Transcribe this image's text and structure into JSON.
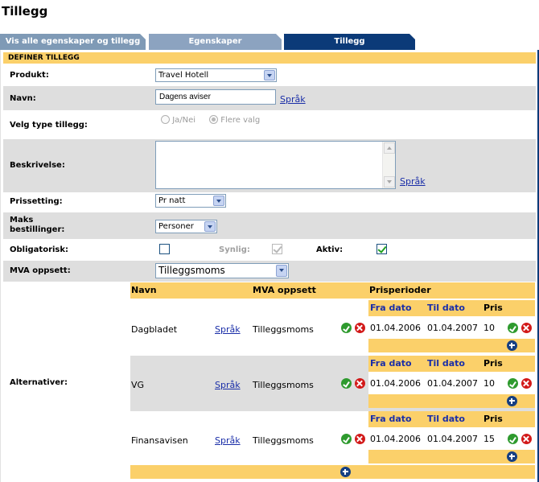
{
  "page": {
    "title": "Tillegg"
  },
  "tabs": [
    {
      "label": "Vis alle egenskaper og tillegg"
    },
    {
      "label": "Egenskaper"
    },
    {
      "label": "Tillegg"
    }
  ],
  "section": {
    "title": "DEFINER TILLEGG"
  },
  "form": {
    "produkt": {
      "label": "Produkt:",
      "value": "Travel Hotell"
    },
    "navn": {
      "label": "Navn:",
      "value": "Dagens aviser",
      "lang_link": "Språk"
    },
    "type": {
      "label": "Velg type tillegg:",
      "option_a": "Ja/Nei",
      "option_b": "Flere valg",
      "selected": "Flere valg"
    },
    "beskrivelse": {
      "label": "Beskrivelse:",
      "value": "",
      "lang_link": "Språk"
    },
    "prissetting": {
      "label": "Prissetting:",
      "value": "Pr natt"
    },
    "maks": {
      "label_line1": "Maks",
      "label_line2": "bestillinger:",
      "value": "Personer"
    },
    "obligatorisk": {
      "label": "Obligatorisk:",
      "checked": false
    },
    "synlig": {
      "label": "Synlig:",
      "checked": true
    },
    "aktiv": {
      "label": "Aktiv:",
      "checked": true
    },
    "mva": {
      "label": "MVA oppsett:",
      "value": "Tilleggsmoms"
    },
    "alternativer_label": "Alternativer:"
  },
  "alternatives": {
    "headers": {
      "navn": "Navn",
      "mva": "MVA oppsett",
      "prisperioder": "Prisperioder"
    },
    "period_headers": {
      "fra": "Fra dato",
      "til": "Til dato",
      "pris": "Pris"
    },
    "lang_link": "Språk",
    "rows": [
      {
        "navn": "Dagbladet",
        "mva": "Tilleggsmoms",
        "fra": "01.04.2006",
        "til": "01.04.2007",
        "pris": "10"
      },
      {
        "navn": "VG",
        "mva": "Tilleggsmoms",
        "fra": "01.04.2006",
        "til": "01.04.2007",
        "pris": "10"
      },
      {
        "navn": "Finansavisen",
        "mva": "Tilleggsmoms",
        "fra": "01.04.2006",
        "til": "01.04.2007",
        "pris": "15"
      }
    ]
  },
  "icons": {
    "ok": "check-icon",
    "delete": "delete-icon",
    "add": "add-icon"
  },
  "colors": {
    "tab_active": "#0b3a78",
    "tab_inactive": "#7f9ab6",
    "header_bg": "#fbd06a",
    "row_grey": "#dedede"
  }
}
